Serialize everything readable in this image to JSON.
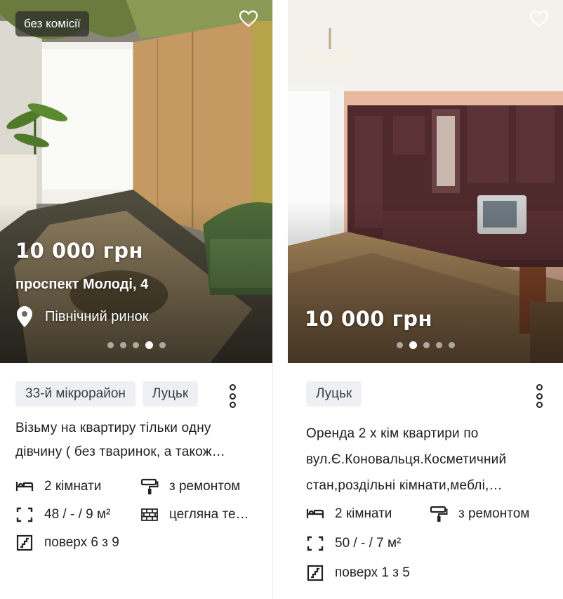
{
  "listings": [
    {
      "badge": "без комісії",
      "price": "10 000 грн",
      "street": "проспект Молоді, 4",
      "landmark": "Північний ринок",
      "photo_index": 4,
      "photo_count": 5,
      "tags": [
        "33-й мікрорайон",
        "Луцьк"
      ],
      "description_line1": "Візьму на квартиру тільки одну",
      "description_line2": "дівчину ( без тваринок, а також…",
      "rooms": "2 кімнати",
      "renovation": "з ремонтом",
      "area": "48 / - / 9 м²",
      "material": "цегляна те…",
      "floor": "поверх 6 з 9",
      "icons": {
        "favorite": "heart-outline-icon",
        "location": "map-pin-icon",
        "menu": "vertical-dots-icon",
        "rooms": "bed-icon",
        "renovation": "paint-roller-icon",
        "area": "area-frame-icon",
        "material": "brick-wall-icon",
        "floor": "stairs-icon"
      }
    },
    {
      "price": "10 000 грн",
      "photo_index": 2,
      "photo_count": 5,
      "tags": [
        "Луцьк"
      ],
      "description_line1": "Оренда 2 х кім квартири по",
      "description_line2": "вул.Є.Коновальця.Косметичний",
      "description_line3": "стан,роздільні кімнати,меблі,…",
      "rooms": "2 кімнати",
      "renovation": "з ремонтом",
      "area": "50 / - / 7 м²",
      "floor": "поверх 1 з 5",
      "icons": {
        "favorite": "heart-outline-icon",
        "menu": "vertical-dots-icon",
        "rooms": "bed-icon",
        "renovation": "paint-roller-icon",
        "area": "area-frame-icon",
        "floor": "stairs-icon"
      }
    }
  ],
  "colors": {
    "chip_bg": "#eef0f3",
    "text": "#1e1e1e",
    "overlay_text": "#ffffff"
  }
}
